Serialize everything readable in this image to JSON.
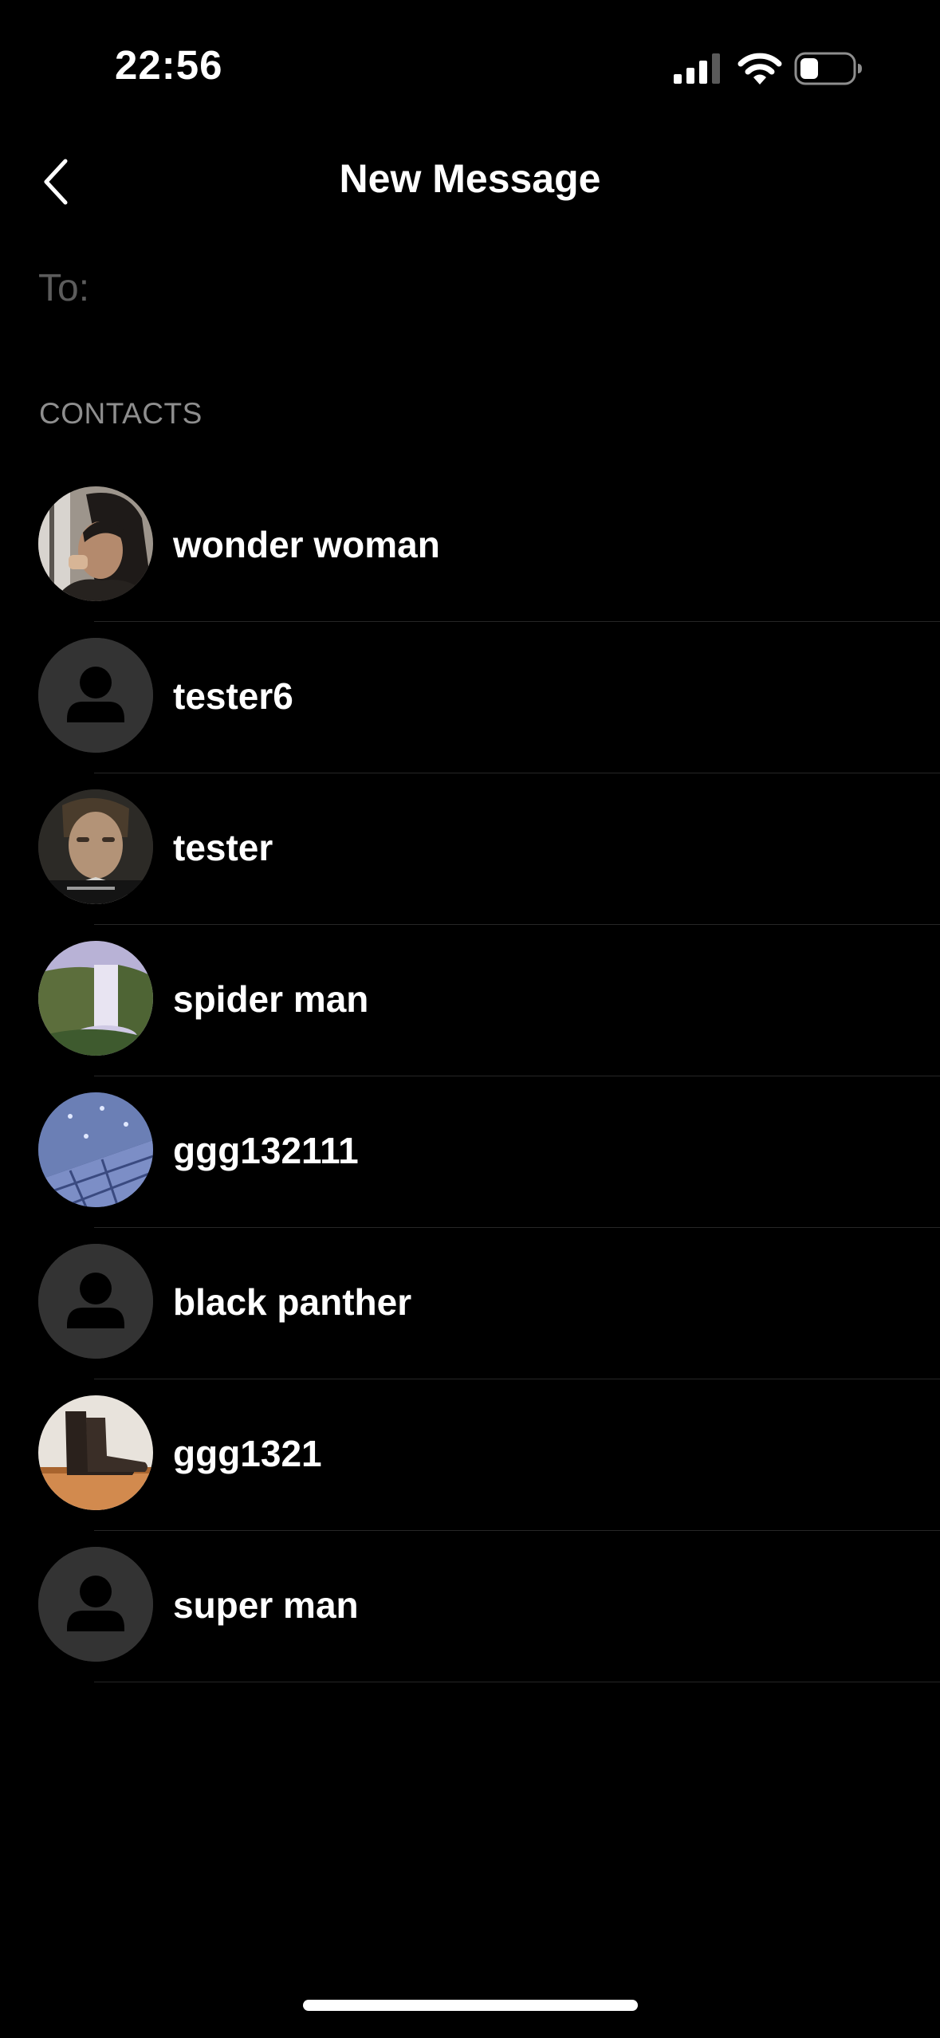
{
  "status_bar": {
    "time": "22:56",
    "icons": [
      "signal-icon",
      "wifi-icon",
      "battery-icon"
    ]
  },
  "nav": {
    "back_icon": "chevron-left-icon",
    "title": "New Message"
  },
  "recipient": {
    "label": "To:",
    "value": ""
  },
  "contacts": {
    "header": "CONTACTS",
    "items": [
      {
        "name": "wonder woman",
        "avatar": "photo-person"
      },
      {
        "name": "tester6",
        "avatar": "default-person-icon"
      },
      {
        "name": "tester",
        "avatar": "photo-face"
      },
      {
        "name": "spider man",
        "avatar": "photo-waterfall"
      },
      {
        "name": "ggg132111",
        "avatar": "photo-building"
      },
      {
        "name": "black panther",
        "avatar": "default-person-icon"
      },
      {
        "name": "ggg1321",
        "avatar": "photo-boots"
      },
      {
        "name": "super man",
        "avatar": "default-person-icon"
      }
    ]
  },
  "colors": {
    "background": "#000000",
    "text": "#ffffff",
    "muted": "#8e8e8e",
    "placeholder": "#5c5c5c",
    "avatar_default": "#333333",
    "divider": "#262626"
  }
}
